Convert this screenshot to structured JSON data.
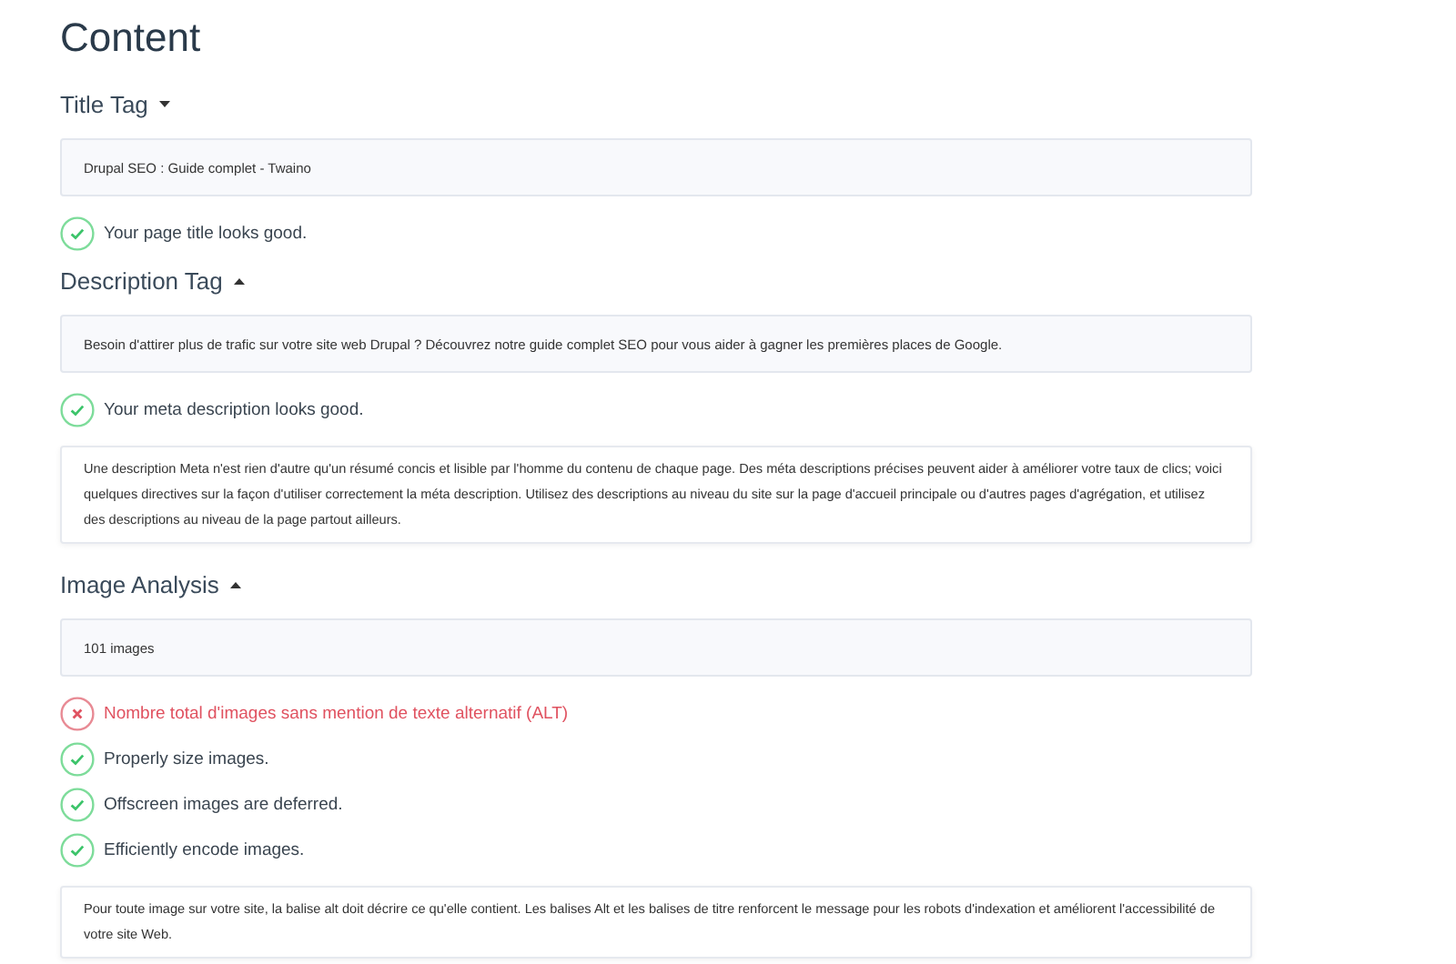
{
  "heading": "Content",
  "sections": [
    {
      "title": "Title Tag",
      "expanded": false,
      "items": [
        {
          "kind": "box",
          "text": "Drupal SEO : Guide complet - Twaino"
        },
        {
          "kind": "check",
          "passed": true,
          "text": "Your page title looks good."
        }
      ]
    },
    {
      "title": "Description Tag",
      "expanded": true,
      "items": [
        {
          "kind": "box",
          "text": "Besoin d'attirer plus de trafic sur votre site web Drupal ? Découvrez notre guide complet SEO pour vous aider à gagner les premières places de Google."
        },
        {
          "kind": "check",
          "passed": true,
          "text": "Your meta description looks good."
        },
        {
          "kind": "note",
          "text": "Une description Meta n'est rien d'autre qu'un résumé concis et lisible par l'homme du contenu de chaque page. Des méta descriptions précises peuvent aider à améliorer votre taux de clics; voici quelques directives sur la façon d'utiliser correctement la méta description. Utilisez des descriptions au niveau du site sur la page d'accueil principale ou d'autres pages d'agrégation, et utilisez des descriptions au niveau de la page partout ailleurs."
        }
      ]
    },
    {
      "title": "Image Analysis",
      "expanded": true,
      "items": [
        {
          "kind": "box",
          "text": "101 images"
        },
        {
          "kind": "check",
          "passed": false,
          "text": "Nombre total d'images sans mention de texte alternatif (ALT)"
        },
        {
          "kind": "check",
          "passed": true,
          "text": "Properly size images."
        },
        {
          "kind": "check",
          "passed": true,
          "text": "Offscreen images are deferred."
        },
        {
          "kind": "check",
          "passed": true,
          "text": "Efficiently encode images."
        },
        {
          "kind": "note",
          "text": "Pour toute image sur votre site, la balise alt doit décrire ce qu'elle contient. Les balises Alt et les balises de titre renforcent le message pour les robots d'indexation et améliorent l'accessibilité de votre site Web."
        }
      ]
    }
  ]
}
